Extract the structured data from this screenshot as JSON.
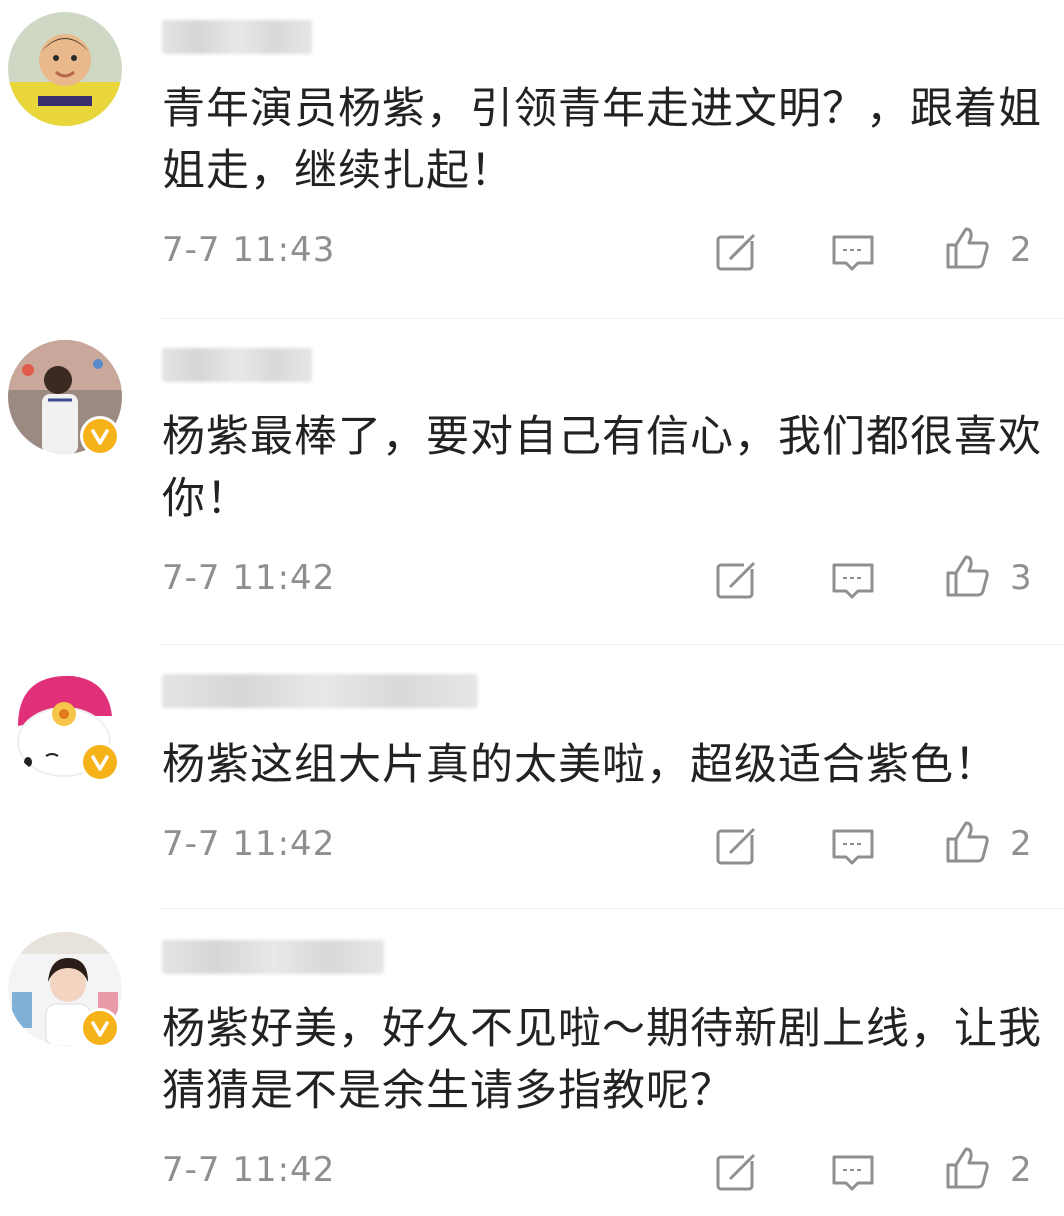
{
  "comments": [
    {
      "text": "青年演员杨紫，引领青年走进文明？，跟着姐姐走，继续扎起！",
      "time": "7-7 11:43",
      "likes": "2",
      "verified": false
    },
    {
      "text": "杨紫最棒了，要对自己有信心，我们都很喜欢你！",
      "time": "7-7 11:42",
      "likes": "3",
      "verified": true
    },
    {
      "text": "杨紫这组大片真的太美啦，超级适合紫色！",
      "time": "7-7 11:42",
      "likes": "2",
      "verified": true
    },
    {
      "text": "杨紫好美，好久不见啦～期待新剧上线，让我猜猜是不是余生请多指教呢？",
      "time": "7-7 11:42",
      "likes": "2",
      "verified": true
    }
  ],
  "colors": {
    "text": "#222222",
    "meta": "#8f8f8f",
    "verified_badge": "#f5b319"
  },
  "icons": [
    "repost-icon",
    "comment-icon",
    "like-icon"
  ]
}
